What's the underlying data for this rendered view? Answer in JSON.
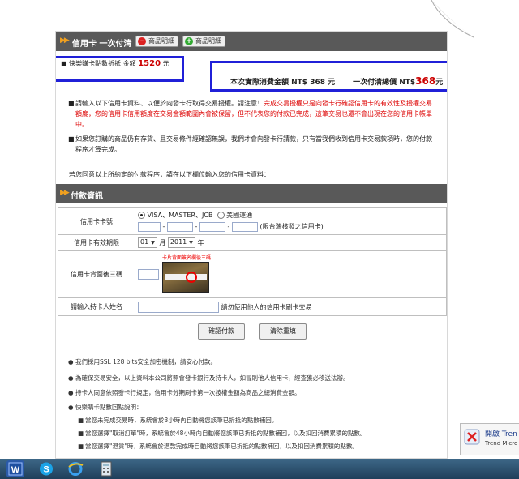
{
  "header": {
    "title": "信用卡 一次付清",
    "btn_print": "商品明細",
    "btn_add": "商品明細"
  },
  "summary": {
    "discount_prefix": "快樂購卡點數折抵 金額",
    "discount_value": "1520",
    "discount_unit": "元",
    "actual_label": "本次實際消費金額 NT$ 368 元",
    "total_label": "一次付清總價 NT$",
    "total_value": "368",
    "total_unit": "元"
  },
  "notices": {
    "n1_black": "請輸入以下信用卡資料、以便於向發卡行取得交易授權。請注意！",
    "n1_red": "完成交易授權只是向發卡行確認信用卡的有效性及授權交易額度，您的信用卡信用額度在交易金額範圍內會被保留，但不代表您的付款已完成，這筆交易也還不會出現在您的信用卡帳單中。",
    "n2": "如果您訂購的商品仍有存貨、且交易條件經確認無誤，我們才會向發卡行請款，只有當我們收到信用卡交易款項時，您的付款程序才算完成。",
    "agree": "若您同意以上所約定的付款程序，請在以下欄位輸入您的信用卡資料："
  },
  "payment": {
    "title": "付款資訊",
    "card_no_label": "信用卡卡號",
    "card_type_visa": "VISA、MASTER、JCB",
    "card_type_ae": "美國運通",
    "card_no_note": "(限台灣核發之信用卡)",
    "expiry_label": "信用卡有效期限",
    "expiry_month": "01",
    "month_unit": "月",
    "expiry_year": "2011",
    "year_unit": "年",
    "cvv_label": "信用卡背面後三碼",
    "cvv_caption": "卡片背面簽名欄後三碼",
    "holder_label": "請輸入持卡人姓名",
    "holder_note": "請勿使用他人的信用卡刷卡交易"
  },
  "buttons": {
    "confirm": "確認付款",
    "reset": "清除重填"
  },
  "info": {
    "i1": "我們採用SSL 128 bits安全加密機制，請安心付款。",
    "i2": "為確保交易安全，以上資料本公司將照會發卡銀行及持卡人，如冒刷他人信用卡，經查獲必移送法辦。",
    "i3": "持卡人同意依照發卡行規定，信用卡分期刷卡第一次按權金額為商品之總消費金額。",
    "i4": "快樂購卡點數回點說明：",
    "s1": "當您未完成交易時，系統會於3小時內自動將您該筆已折抵的點數補回。",
    "s2": "當您選擇\"取消訂單\"時，系統會於48小時內自動將您該筆已折抵的點數補回，以及扣回消費累積的點數。",
    "s3": "當您選擇\"退貨\"時，系統會於退款完成時自動將您該筆已折抵的點數補回，以及扣回消費累積的點數。"
  },
  "popup": {
    "title": "開啟 Tren",
    "sub": "Trend Micro"
  },
  "colors": {
    "header_bg": "#595959",
    "accent_red": "#cc0000",
    "annotation_blue": "#2020d8"
  },
  "icons": [
    "word-icon",
    "skype-icon",
    "ie-icon",
    "calculator-icon"
  ]
}
